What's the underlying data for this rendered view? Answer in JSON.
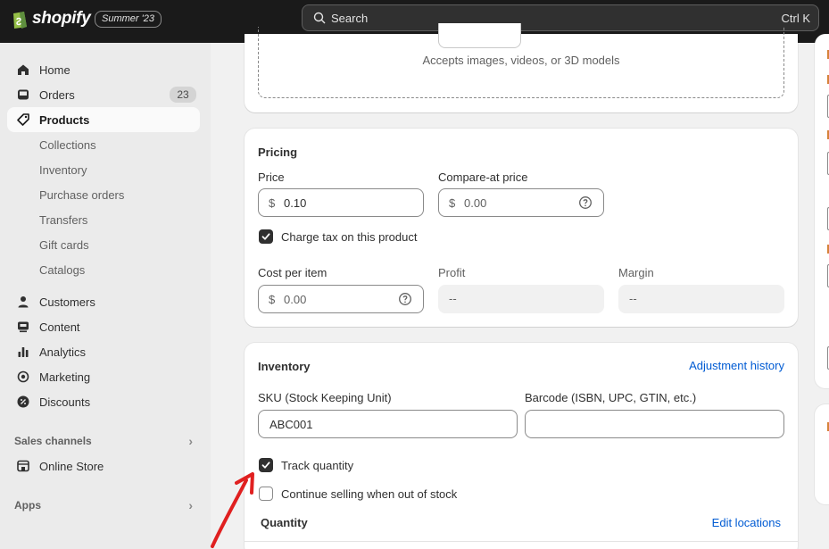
{
  "topbar": {
    "logo_text": "shopify",
    "edition_badge": "Summer '23",
    "search": {
      "label": "Search",
      "shortcut": "Ctrl K",
      "icon": "search-icon"
    }
  },
  "sidebar": {
    "items": [
      {
        "label": "Home",
        "icon": "home-icon"
      },
      {
        "label": "Orders",
        "icon": "inbox-icon",
        "count": "23"
      },
      {
        "label": "Products",
        "icon": "tag-icon",
        "active": true
      },
      {
        "label": "Collections",
        "sub": true
      },
      {
        "label": "Inventory",
        "sub": true
      },
      {
        "label": "Purchase orders",
        "sub": true
      },
      {
        "label": "Transfers",
        "sub": true
      },
      {
        "label": "Gift cards",
        "sub": true
      },
      {
        "label": "Catalogs",
        "sub": true
      },
      {
        "label": "Customers",
        "icon": "person-icon"
      },
      {
        "label": "Content",
        "icon": "content-icon"
      },
      {
        "label": "Analytics",
        "icon": "bar-chart-icon"
      },
      {
        "label": "Marketing",
        "icon": "target-icon"
      },
      {
        "label": "Discounts",
        "icon": "discount-icon"
      }
    ],
    "sales_channels": {
      "heading": "Sales channels",
      "items": [
        {
          "label": "Online Store",
          "icon": "store-icon"
        }
      ]
    },
    "apps": {
      "heading": "Apps"
    }
  },
  "media": {
    "hint": "Accepts images, videos, or 3D models"
  },
  "pricing": {
    "title": "Pricing",
    "price": {
      "label": "Price",
      "prefix": "$",
      "value": "0.10"
    },
    "compare_at": {
      "label": "Compare-at price",
      "prefix": "$",
      "placeholder": "0.00"
    },
    "charge_tax": {
      "label": "Charge tax on this product",
      "checked": true
    },
    "cost_per_item": {
      "label": "Cost per item",
      "prefix": "$",
      "placeholder": "0.00"
    },
    "profit": {
      "label": "Profit",
      "value": "--"
    },
    "margin": {
      "label": "Margin",
      "value": "--"
    }
  },
  "inventory": {
    "title": "Inventory",
    "adjustment_link": "Adjustment history",
    "sku": {
      "label": "SKU (Stock Keeping Unit)",
      "value": "ABC001"
    },
    "barcode": {
      "label": "Barcode (ISBN, UPC, GTIN, etc.)",
      "value": ""
    },
    "track_quantity": {
      "label": "Track quantity",
      "checked": true
    },
    "continue_selling": {
      "label": "Continue selling when out of stock",
      "checked": false
    },
    "quantity": {
      "title": "Quantity",
      "edit_link": "Edit locations"
    }
  },
  "colors": {
    "accent_link": "#005bd3",
    "annotation_arrow": "#e02020"
  }
}
